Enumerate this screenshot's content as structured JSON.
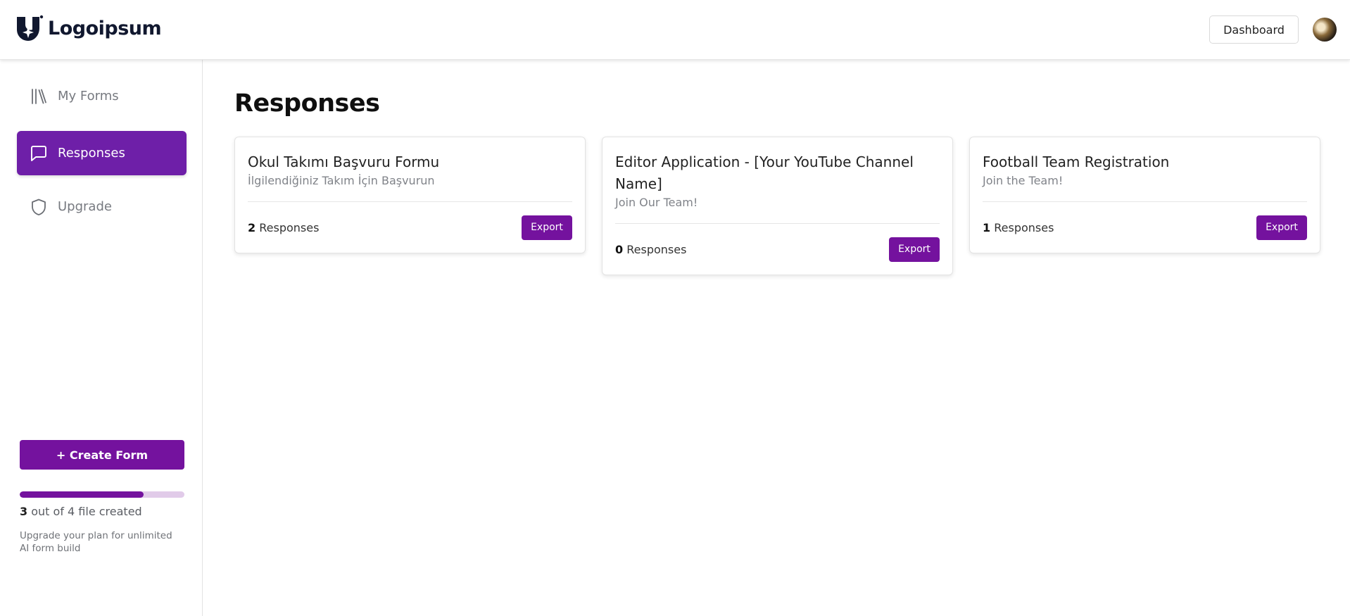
{
  "header": {
    "logo_text": "Logoipsum",
    "dashboard_label": "Dashboard"
  },
  "sidebar": {
    "items": [
      {
        "label": "My Forms",
        "icon": "library-icon",
        "active": false
      },
      {
        "label": "Responses",
        "icon": "message-square-icon",
        "active": true
      },
      {
        "label": "Upgrade",
        "icon": "shield-icon",
        "active": false
      }
    ],
    "create_form_label": "+ Create Form",
    "usage": {
      "used": "3",
      "text": "out of 4 file created",
      "progress_fraction": 0.75
    },
    "upgrade_note": "Upgrade your plan for unlimited AI form build"
  },
  "main": {
    "title": "Responses",
    "cards": [
      {
        "title": "Okul Takımı Başvuru Formu",
        "subtitle": "İlgilendiğiniz Takım İçin Başvurun",
        "count": "2",
        "count_label": "Responses",
        "export_label": "Export"
      },
      {
        "title": "Editor Application - [Your YouTube Channel Name]",
        "subtitle": "Join Our Team!",
        "count": "0",
        "count_label": "Responses",
        "export_label": "Export"
      },
      {
        "title": "Football Team Registration",
        "subtitle": "Join the Team!",
        "count": "1",
        "count_label": "Responses",
        "export_label": "Export"
      }
    ]
  },
  "colors": {
    "accent": "#74129e",
    "active_nav": "#6e1fa8",
    "progress_track": "#e1cbe9"
  }
}
